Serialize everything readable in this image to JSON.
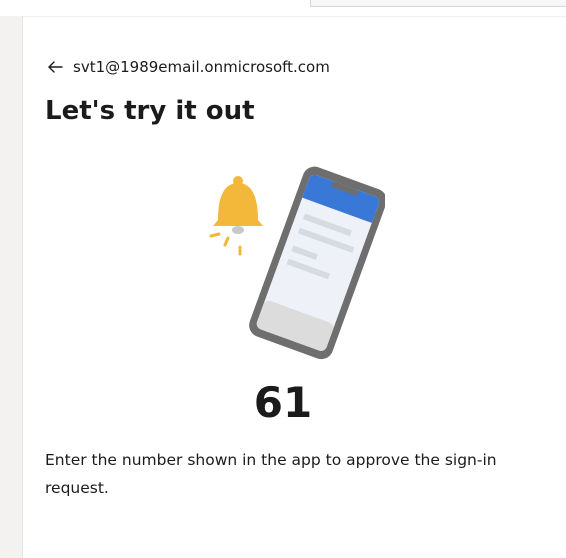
{
  "account": {
    "email": "svt1@1989email.onmicrosoft.com",
    "back_icon": "arrow-left-icon"
  },
  "heading": "Let's try it out",
  "illustration": {
    "icons": [
      "bell-icon",
      "phone-icon"
    ],
    "bell_color": "#f3b73a",
    "phone_header_color": "#3a78d8",
    "phone_frame_color": "#6e6e6e"
  },
  "verification": {
    "number": "61",
    "instruction": "Enter the number shown in the app to approve the sign-in request."
  }
}
